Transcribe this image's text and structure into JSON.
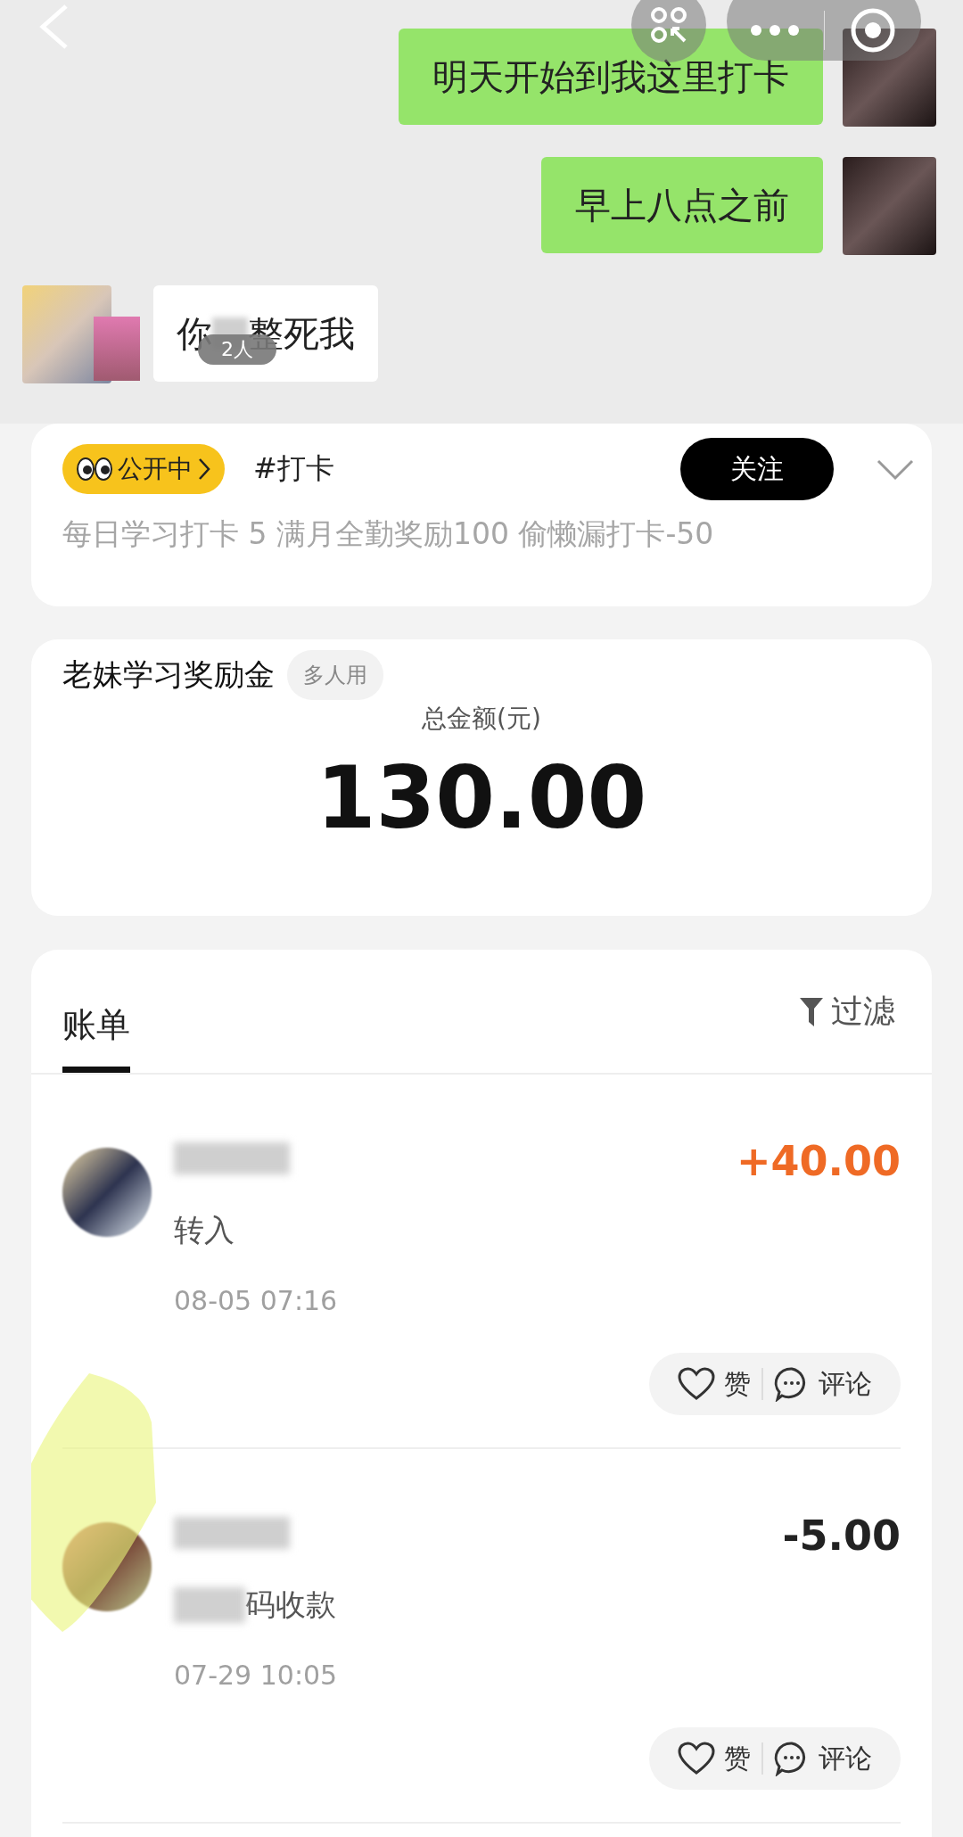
{
  "chat": {
    "messages": [
      {
        "kind": "outgoing",
        "parts": [
          "明天开始到我这里打卡"
        ]
      },
      {
        "kind": "outgoing",
        "parts": [
          "早上八点之前"
        ]
      },
      {
        "kind": "incoming",
        "parts": [
          "你",
          "整死我"
        ],
        "badge": "2人"
      }
    ]
  },
  "topic": {
    "status": "公开中",
    "tag": "#打卡",
    "follow_button": "关注",
    "description": "每日学习打卡 5 满月全勤奖励100 偷懒漏打卡-50"
  },
  "fund": {
    "title": "老妹学习奖励金",
    "badge": "多人用",
    "total_label": "总金额(元)",
    "total": "130.00"
  },
  "bills": {
    "tabs": [
      {
        "label": "账单",
        "selected": true
      }
    ],
    "filter": "过滤",
    "entries": [
      {
        "kind": "income",
        "amount": "+40.00",
        "description": "转入",
        "description_obscured": false,
        "time": "08-05 07:16",
        "like": "赞",
        "comment": "评论"
      },
      {
        "kind": "expense",
        "amount": "-5.00",
        "description": "码收款",
        "description_obscured": true,
        "time": "07-29 10:05",
        "like": "赞",
        "comment": "评论"
      }
    ]
  }
}
